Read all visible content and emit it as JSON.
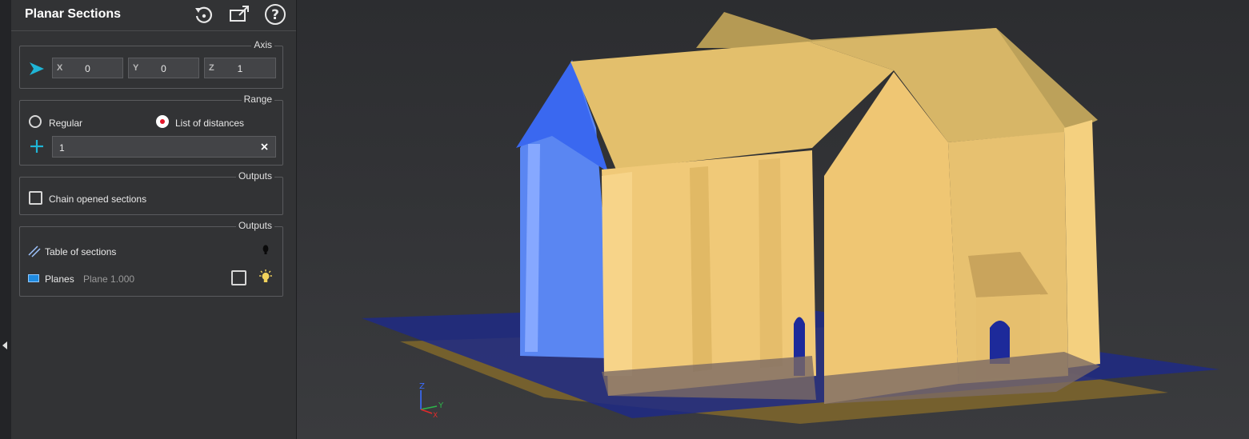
{
  "panel": {
    "title": "Planar Sections",
    "header_icons": [
      "reset-icon",
      "export-icon",
      "help-icon"
    ]
  },
  "axis": {
    "group_label": "Axis",
    "x_label": "X",
    "x_value": "0",
    "y_label": "Y",
    "y_value": "0",
    "z_label": "Z",
    "z_value": "1"
  },
  "range": {
    "group_label": "Range",
    "regular_label": "Regular",
    "list_label": "List of distances",
    "selected": "List of distances",
    "distance_value": "1"
  },
  "outputs_options": {
    "group_label": "Outputs",
    "chain_label": "Chain opened sections",
    "chain_checked": false
  },
  "outputs": {
    "group_label": "Outputs",
    "table_label": "Table of sections",
    "planes_label": "Planes",
    "planes_value": "Plane 1.000"
  },
  "viewport": {
    "axis_x": "X",
    "axis_y": "Y",
    "axis_z": "Z"
  },
  "colors": {
    "accent": "#1fb5d6",
    "model_fill": "#e9c571",
    "plane_fill": "#1a237e",
    "interior": "#5a86f2",
    "radio_dot": "#e3172b"
  }
}
